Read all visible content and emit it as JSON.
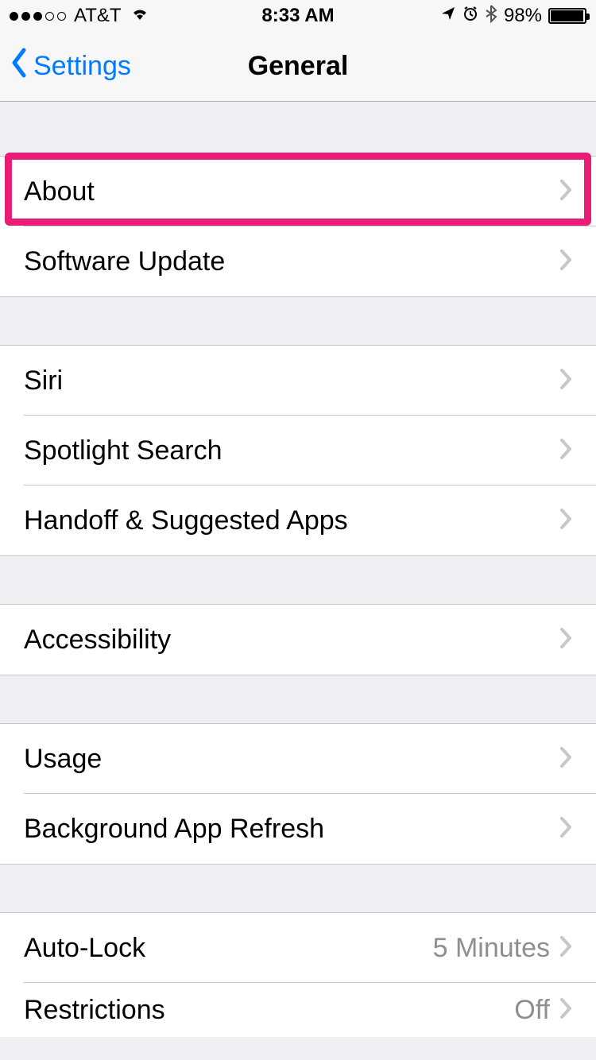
{
  "status_bar": {
    "carrier": "AT&T",
    "time": "8:33 AM",
    "battery_percent": "98%",
    "signal_strength": 3
  },
  "nav": {
    "back_label": "Settings",
    "title": "General"
  },
  "groups": [
    {
      "rows": [
        {
          "label": "About",
          "value": ""
        },
        {
          "label": "Software Update",
          "value": ""
        }
      ]
    },
    {
      "rows": [
        {
          "label": "Siri",
          "value": ""
        },
        {
          "label": "Spotlight Search",
          "value": ""
        },
        {
          "label": "Handoff & Suggested Apps",
          "value": ""
        }
      ]
    },
    {
      "rows": [
        {
          "label": "Accessibility",
          "value": ""
        }
      ]
    },
    {
      "rows": [
        {
          "label": "Usage",
          "value": ""
        },
        {
          "label": "Background App Refresh",
          "value": ""
        }
      ]
    },
    {
      "rows": [
        {
          "label": "Auto-Lock",
          "value": "5 Minutes"
        },
        {
          "label": "Restrictions",
          "value": "Off"
        }
      ]
    }
  ],
  "highlight": {
    "target_label": "About"
  }
}
